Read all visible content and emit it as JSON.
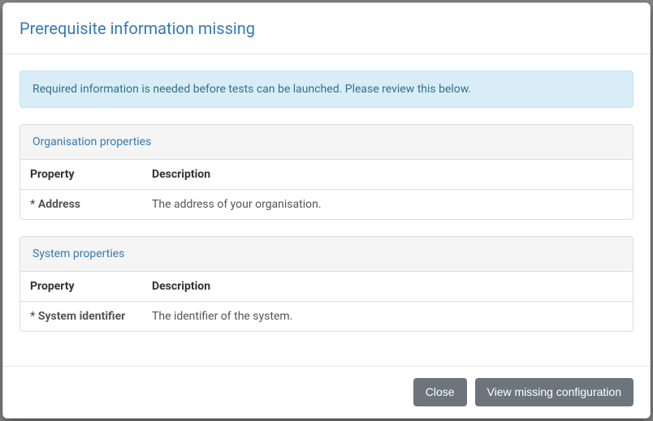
{
  "modal": {
    "title": "Prerequisite information missing",
    "alert": "Required information is needed before tests can be launched. Please review this below."
  },
  "sections": {
    "org": {
      "title": "Organisation properties",
      "headers": {
        "property": "Property",
        "description": "Description"
      },
      "rows": [
        {
          "name": "* Address",
          "description": "The address of your organisation."
        }
      ]
    },
    "system": {
      "title": "System properties",
      "headers": {
        "property": "Property",
        "description": "Description"
      },
      "rows": [
        {
          "name": "* System identifier",
          "description": "The identifier of the system."
        }
      ]
    }
  },
  "footer": {
    "close": "Close",
    "view": "View missing configuration"
  }
}
